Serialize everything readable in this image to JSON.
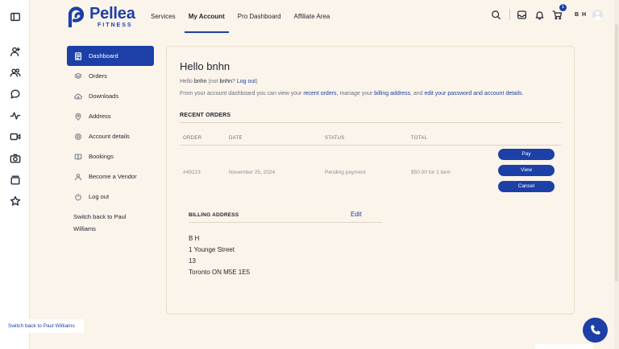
{
  "rail": {
    "icons": [
      "sidebar-toggle-icon",
      "user-add-icon",
      "users-icon",
      "chat-icon",
      "activity-icon",
      "video-icon",
      "camera-icon",
      "folder-icon",
      "star-icon"
    ]
  },
  "header": {
    "logo_name": "Pellea",
    "logo_sub": "FITNESS",
    "nav": [
      "Services",
      "My Account",
      "Pro Dashboard",
      "Affiliate Area"
    ],
    "active_nav": "My Account",
    "cart_count": "1",
    "user_initials": "B H"
  },
  "menu": {
    "items": [
      {
        "label": "Dashboard",
        "icon": "dashboard-icon"
      },
      {
        "label": "Orders",
        "icon": "orders-icon"
      },
      {
        "label": "Downloads",
        "icon": "downloads-icon"
      },
      {
        "label": "Address",
        "icon": "address-icon"
      },
      {
        "label": "Account details",
        "icon": "settings-icon"
      },
      {
        "label": "Bookings",
        "icon": "book-icon"
      },
      {
        "label": "Become a Vendor",
        "icon": "user-icon"
      },
      {
        "label": "Log out",
        "icon": "power-icon"
      }
    ],
    "switch_back": "Switch back to Paul Williams"
  },
  "main": {
    "greeting": "Hello bnhn",
    "intro": {
      "hello": "Hello ",
      "user": "bnhn",
      "not": " (not ",
      "user2": "bnhn",
      "q": "? ",
      "logout": "Log out",
      "close": ")"
    },
    "desc": {
      "p1": "From your account dashboard you can view your ",
      "recent_orders": "recent orders",
      "p2": ", manage your ",
      "billing_address": "billing address",
      "p3": ", and ",
      "edit_password": "edit your password and account details",
      "p4": "."
    },
    "recent_orders_title": "RECENT ORDERS",
    "table": {
      "headers": [
        "ORDER",
        "DATE",
        "STATUS",
        "TOTAL"
      ],
      "row": {
        "order": "#49223",
        "date": "November 25, 2024",
        "status": "Pending payment",
        "total": "$50.00 for 1 item"
      },
      "actions": [
        "Pay",
        "View",
        "Cancel"
      ]
    },
    "billing": {
      "title": "BILLING ADDRESS",
      "edit": "Edit",
      "lines": [
        "B H",
        "1 Younge Street",
        "13",
        "Toronto ON M5E 1E5"
      ]
    }
  },
  "toast": "Switch back to Paul Williams",
  "colors": {
    "accent": "#1c3fa8",
    "background": "#fbf4ea"
  }
}
